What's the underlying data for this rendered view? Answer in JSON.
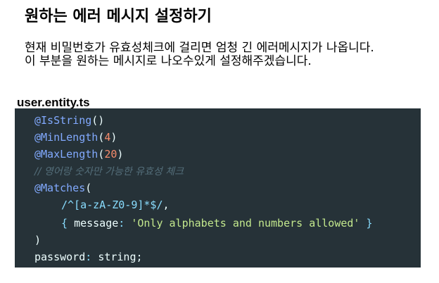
{
  "document": {
    "title": "원하는 에러 메시지 설정하기",
    "paragraphs": [
      "현재 비밀번호가 유효성체크에 걸리면 엄청 긴 에러메시지가 나옵니다.",
      "이 부분을 원하는 메시지로 나오수있게 설정해주겠습니다."
    ]
  },
  "code": {
    "filename": "user.entity.ts",
    "lines": {
      "l1_decorator": "@IsString",
      "l1_parens": "()",
      "l2_decorator": "@MinLength",
      "l2_open": "(",
      "l2_number": "4",
      "l2_close": ")",
      "l3_decorator": "@MaxLength",
      "l3_open": "(",
      "l3_number": "20",
      "l3_close": ")",
      "l4_comment": "// 영어랑 숫자만 가능한 유효성 체크",
      "l5_decorator": "@Matches",
      "l5_open": "(",
      "l6_regex": "/^[a-zA-Z0-9]*$/",
      "l6_comma": ",",
      "l7_open_brace": "{ ",
      "l7_key": "message",
      "l7_colon": ": ",
      "l7_string": "'Only alphabets and numbers allowed'",
      "l7_close_brace": " }",
      "l8_close": ")",
      "l9_prop": "password",
      "l9_colon": ": ",
      "l9_type": "string",
      "l9_semicolon": ";"
    }
  },
  "colors": {
    "code_background": "#263238",
    "decorator": "#82aaff",
    "number": "#f78c6c",
    "comment": "#546e7a",
    "string": "#c3e88d"
  }
}
